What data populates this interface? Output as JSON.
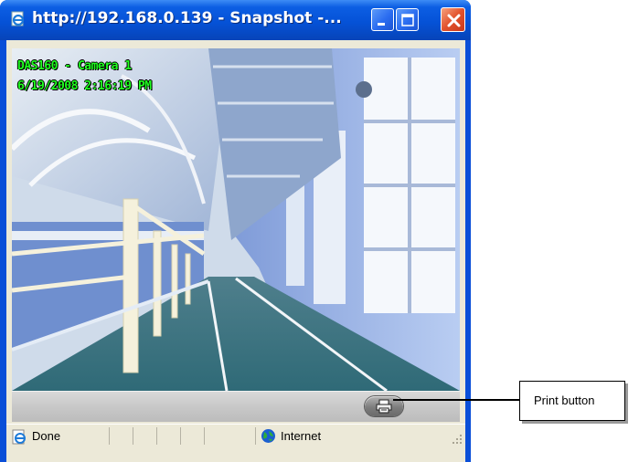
{
  "window": {
    "title": "http://192.168.0.139 - Snapshot -...",
    "title_icon": "ie-page-icon",
    "buttons": [
      "minimize-icon",
      "maximize-icon",
      "close-icon"
    ]
  },
  "snapshot": {
    "overlay_line1": "DAS160 - Camera 1",
    "overlay_line2": "6/19/2008 2:16:19 PM"
  },
  "toolbar": {
    "print_icon": "printer-icon"
  },
  "statusbar": {
    "status": "Done",
    "zone": "Internet"
  },
  "callout": {
    "label": "Print button"
  },
  "colors": {
    "titlebar": "#0552d7",
    "close_button": "#e2522c",
    "overlay_text": "#20ff20",
    "client_bg": "#ece9d8"
  }
}
